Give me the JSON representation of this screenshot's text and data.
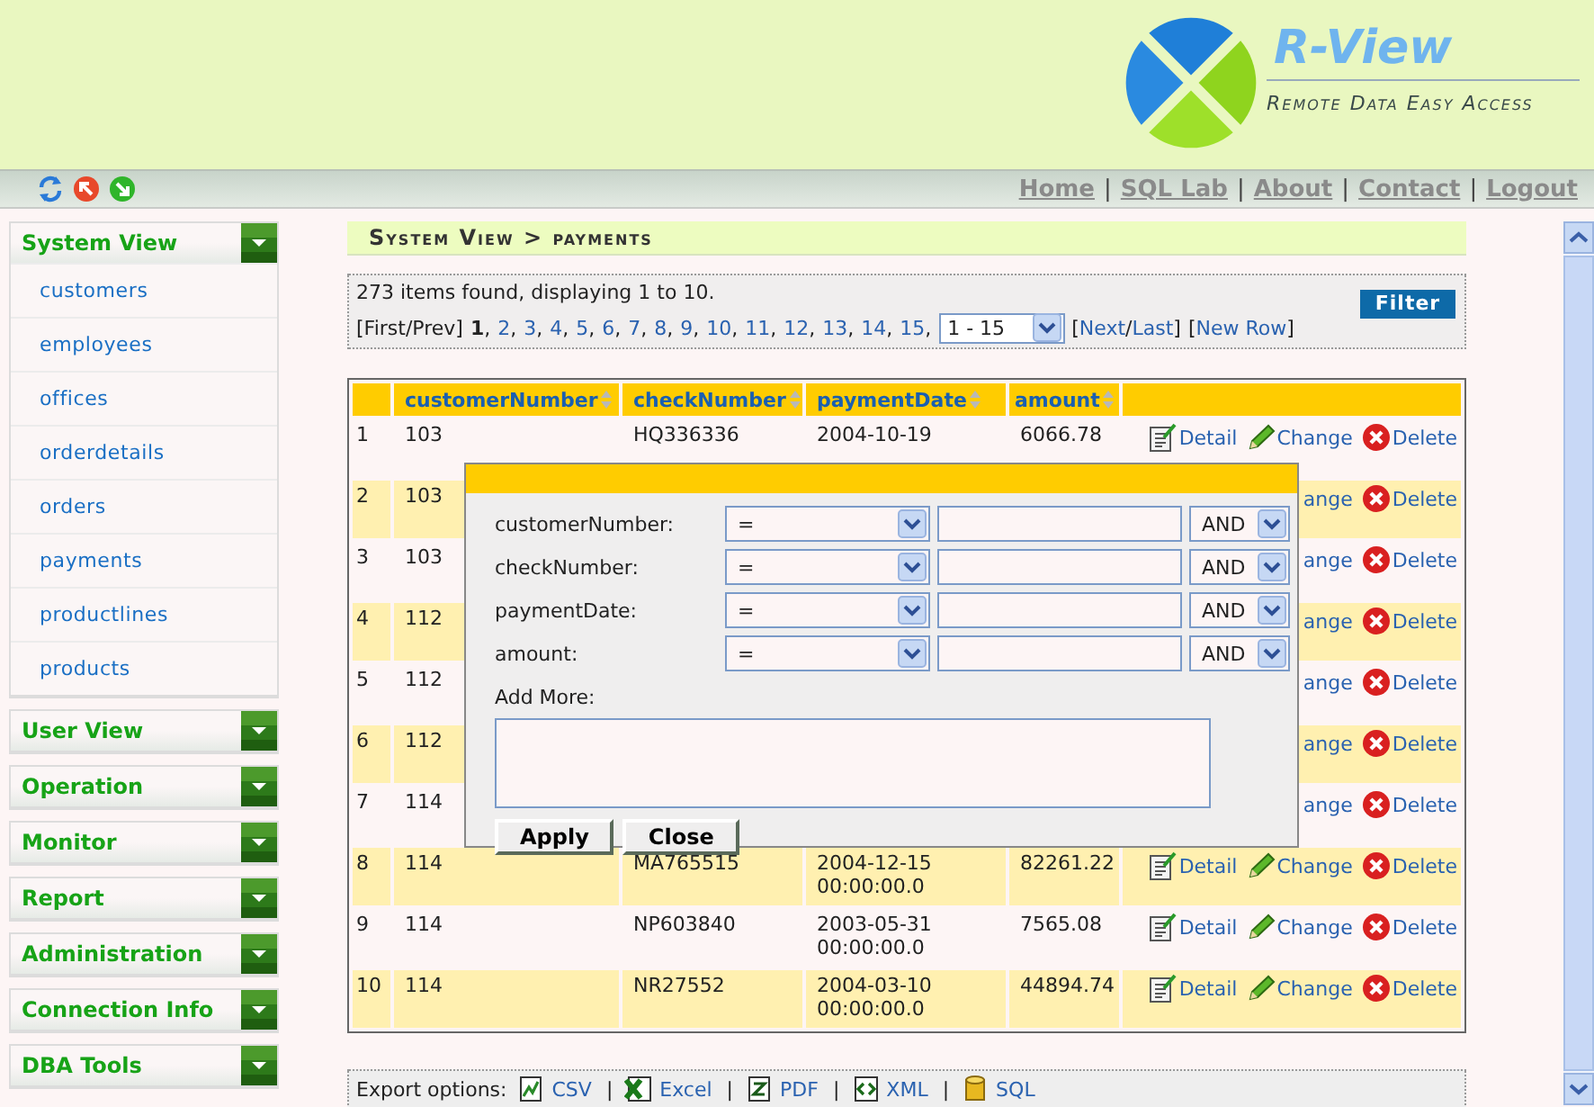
{
  "header": {
    "logo_title": "R-View",
    "logo_tagline": "Remote Data Easy Access"
  },
  "toolbar": {
    "nav": [
      {
        "kind": "link",
        "text": "Home"
      },
      {
        "kind": "sep",
        "text": "|"
      },
      {
        "kind": "link",
        "text": "SQL Lab"
      },
      {
        "kind": "sep",
        "text": "|"
      },
      {
        "kind": "link",
        "text": "About"
      },
      {
        "kind": "sep",
        "text": "|"
      },
      {
        "kind": "link",
        "text": "Contact"
      },
      {
        "kind": "sep",
        "text": "|"
      },
      {
        "kind": "link",
        "text": "Logout"
      }
    ]
  },
  "sidebar": {
    "sections": [
      {
        "title": "System View",
        "items": [
          "customers",
          "employees",
          "offices",
          "orderdetails",
          "orders",
          "payments",
          "productlines",
          "products"
        ]
      },
      {
        "title": "User View"
      },
      {
        "title": "Operation"
      },
      {
        "title": "Monitor"
      },
      {
        "title": "Report"
      },
      {
        "title": "Administration"
      },
      {
        "title": "Connection Info"
      },
      {
        "title": "DBA Tools"
      }
    ]
  },
  "breadcrumb": "System View > payments",
  "summary": "273 items found, displaying 1 to 10.",
  "pager": [
    {
      "kind": "text",
      "text": "[First/Prev]"
    },
    {
      "kind": "current",
      "text": "1"
    },
    {
      "kind": "comma",
      "text": ","
    },
    {
      "kind": "link",
      "text": "2"
    },
    {
      "kind": "comma",
      "text": ","
    },
    {
      "kind": "link",
      "text": "3"
    },
    {
      "kind": "comma",
      "text": ","
    },
    {
      "kind": "link",
      "text": "4"
    },
    {
      "kind": "comma",
      "text": ","
    },
    {
      "kind": "link",
      "text": "5"
    },
    {
      "kind": "comma",
      "text": ","
    },
    {
      "kind": "link",
      "text": "6"
    },
    {
      "kind": "comma",
      "text": ","
    },
    {
      "kind": "link",
      "text": "7"
    },
    {
      "kind": "comma",
      "text": ","
    },
    {
      "kind": "link",
      "text": "8"
    },
    {
      "kind": "comma",
      "text": ","
    },
    {
      "kind": "link",
      "text": "9"
    },
    {
      "kind": "comma",
      "text": ","
    },
    {
      "kind": "link",
      "text": "10"
    },
    {
      "kind": "comma",
      "text": ","
    },
    {
      "kind": "link",
      "text": "11"
    },
    {
      "kind": "comma",
      "text": ","
    },
    {
      "kind": "link",
      "text": "12"
    },
    {
      "kind": "comma",
      "text": ","
    },
    {
      "kind": "link",
      "text": "13"
    },
    {
      "kind": "comma",
      "text": ","
    },
    {
      "kind": "link",
      "text": "14"
    },
    {
      "kind": "comma",
      "text": ","
    },
    {
      "kind": "link",
      "text": "15"
    },
    {
      "kind": "comma",
      "text": ","
    },
    {
      "kind": "select",
      "text": "1 - 15"
    },
    {
      "kind": "text",
      "text": "["
    },
    {
      "kind": "link",
      "text": "Next"
    },
    {
      "kind": "slash",
      "text": "/"
    },
    {
      "kind": "link",
      "text": "Last"
    },
    {
      "kind": "text",
      "text": "]"
    },
    {
      "kind": "text",
      "text": "["
    },
    {
      "kind": "link",
      "text": "New Row"
    },
    {
      "kind": "text",
      "text": "]"
    }
  ],
  "filter_button": "Filter",
  "table": {
    "columns": [
      "customerNumber",
      "checkNumber",
      "paymentDate",
      "amount"
    ],
    "rows": [
      {
        "index": "1",
        "customer": "103",
        "check": "HQ336336",
        "date": [
          "2004-10-19"
        ],
        "amount": "6066.78",
        "actions": [
          {
            "kind": "detail",
            "label": "Detail"
          },
          {
            "kind": "change",
            "label": "Change"
          },
          {
            "kind": "delete",
            "label": "Delete"
          }
        ]
      },
      {
        "index": "2",
        "customer": "103",
        "actions": [
          {
            "kind": "link",
            "label": "ange"
          },
          {
            "kind": "delete",
            "label": "Delete"
          }
        ]
      },
      {
        "index": "3",
        "customer": "103",
        "actions": [
          {
            "kind": "link",
            "label": "ange"
          },
          {
            "kind": "delete",
            "label": "Delete"
          }
        ]
      },
      {
        "index": "4",
        "customer": "112",
        "actions": [
          {
            "kind": "link",
            "label": "ange"
          },
          {
            "kind": "delete",
            "label": "Delete"
          }
        ]
      },
      {
        "index": "5",
        "customer": "112",
        "actions": [
          {
            "kind": "link",
            "label": "ange"
          },
          {
            "kind": "delete",
            "label": "Delete"
          }
        ]
      },
      {
        "index": "6",
        "customer": "112",
        "actions": [
          {
            "kind": "link",
            "label": "ange"
          },
          {
            "kind": "delete",
            "label": "Delete"
          }
        ]
      },
      {
        "index": "7",
        "customer": "114",
        "actions": [
          {
            "kind": "link",
            "label": "ange"
          },
          {
            "kind": "delete",
            "label": "Delete"
          }
        ]
      },
      {
        "index": "8",
        "customer": "114",
        "check": "MA765515",
        "date": [
          "2004-12-15",
          "00:00:00.0"
        ],
        "amount": "82261.22",
        "actions": [
          {
            "kind": "detail",
            "label": "Detail"
          },
          {
            "kind": "change",
            "label": "Change"
          },
          {
            "kind": "delete",
            "label": "Delete"
          }
        ]
      },
      {
        "index": "9",
        "customer": "114",
        "check": "NP603840",
        "date": [
          "2003-05-31",
          "00:00:00.0"
        ],
        "amount": "7565.08",
        "actions": [
          {
            "kind": "detail",
            "label": "Detail"
          },
          {
            "kind": "change",
            "label": "Change"
          },
          {
            "kind": "delete",
            "label": "Delete"
          }
        ]
      },
      {
        "index": "10",
        "customer": "114",
        "check": "NR27552",
        "date": [
          "2004-03-10",
          "00:00:00.0"
        ],
        "amount": "44894.74",
        "actions": [
          {
            "kind": "detail",
            "label": "Detail"
          },
          {
            "kind": "change",
            "label": "Change"
          },
          {
            "kind": "delete",
            "label": "Delete"
          }
        ]
      }
    ]
  },
  "export": {
    "label": "Export options:",
    "items": [
      {
        "kind": "csv",
        "text": "CSV"
      },
      {
        "kind": "sep",
        "text": "|"
      },
      {
        "kind": "excel",
        "text": "Excel"
      },
      {
        "kind": "sep",
        "text": "|"
      },
      {
        "kind": "pdf",
        "text": "PDF"
      },
      {
        "kind": "sep",
        "text": "|"
      },
      {
        "kind": "xml",
        "text": "XML"
      },
      {
        "kind": "sep",
        "text": "|"
      },
      {
        "kind": "sql",
        "text": "SQL"
      }
    ]
  },
  "filter_dialog": {
    "fields": [
      {
        "label": "customerNumber:",
        "operator": "=",
        "join": "AND"
      },
      {
        "label": "checkNumber:",
        "operator": "=",
        "join": "AND"
      },
      {
        "label": "paymentDate:",
        "operator": "=",
        "join": "AND"
      },
      {
        "label": "amount:",
        "operator": "=",
        "join": "AND"
      }
    ],
    "add_more_label": "Add More:",
    "buttons": [
      "Apply",
      "Close"
    ]
  }
}
